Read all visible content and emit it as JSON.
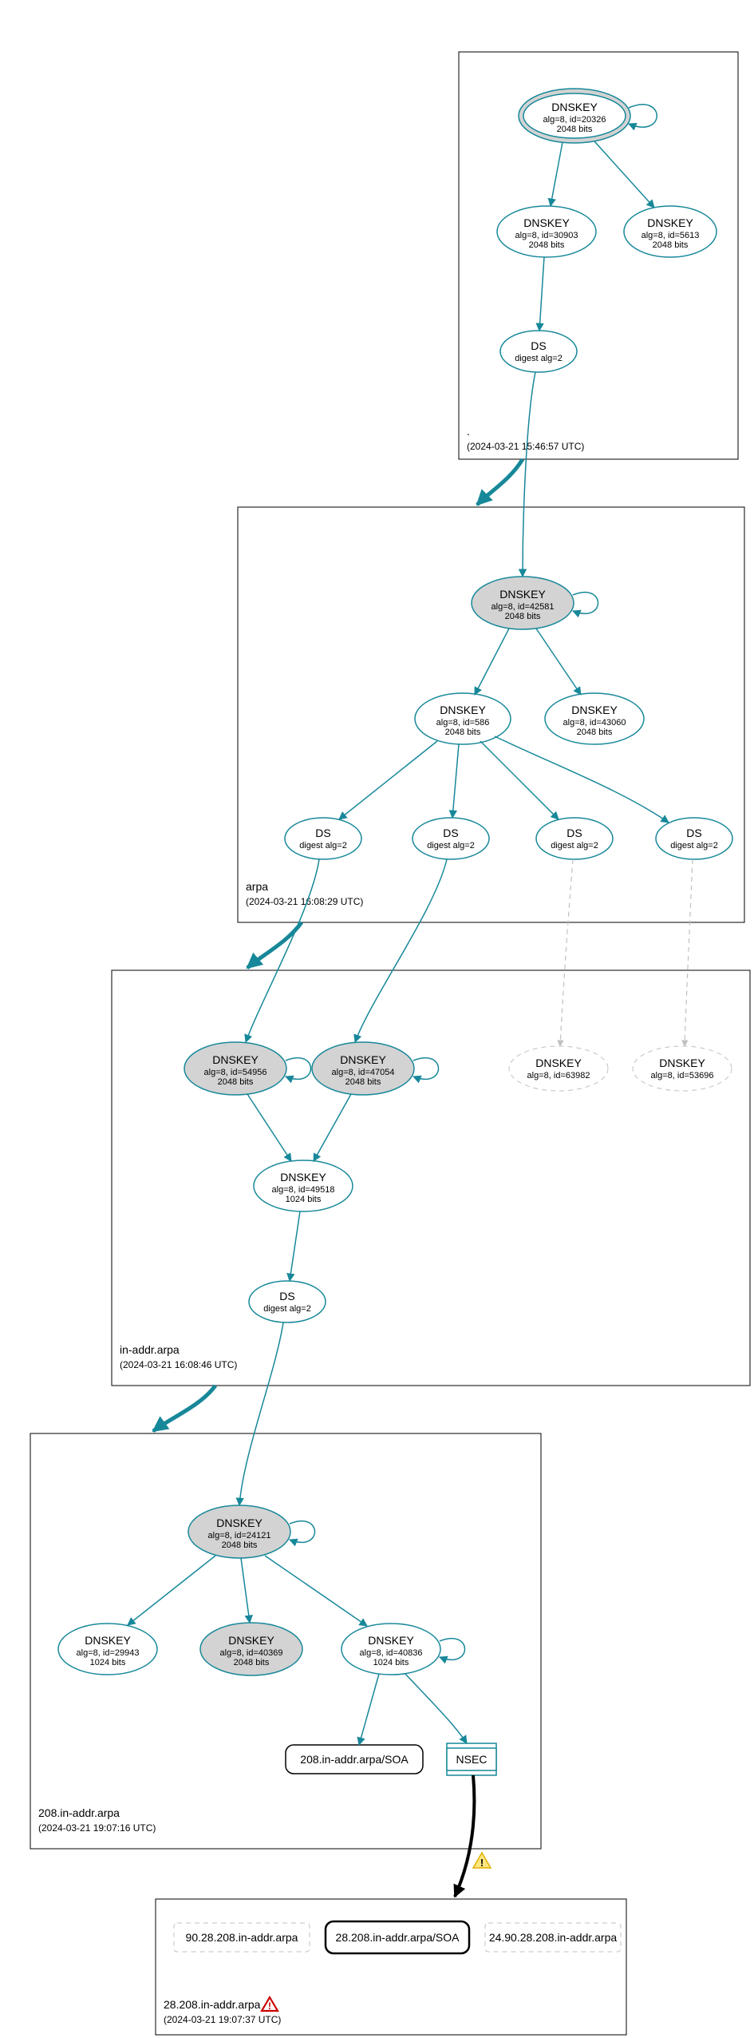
{
  "zones": {
    "root": {
      "label": ".",
      "timestamp": "(2024-03-21 15:46:57 UTC)"
    },
    "arpa": {
      "label": "arpa",
      "timestamp": "(2024-03-21 16:08:29 UTC)"
    },
    "inaddr": {
      "label": "in-addr.arpa",
      "timestamp": "(2024-03-21 16:08:46 UTC)"
    },
    "z208": {
      "label": "208.in-addr.arpa",
      "timestamp": "(2024-03-21 19:07:16 UTC)"
    },
    "z28": {
      "label": "28.208.in-addr.arpa",
      "timestamp": "(2024-03-21 19:07:37 UTC)"
    }
  },
  "nodes": {
    "root_ksk": {
      "title": "DNSKEY",
      "sub1": "alg=8, id=20326",
      "sub2": "2048 bits"
    },
    "root_zsk1": {
      "title": "DNSKEY",
      "sub1": "alg=8, id=30903",
      "sub2": "2048 bits"
    },
    "root_zsk2": {
      "title": "DNSKEY",
      "sub1": "alg=8, id=5613",
      "sub2": "2048 bits"
    },
    "root_ds": {
      "title": "DS",
      "sub1": "digest alg=2"
    },
    "arpa_ksk": {
      "title": "DNSKEY",
      "sub1": "alg=8, id=42581",
      "sub2": "2048 bits"
    },
    "arpa_zsk1": {
      "title": "DNSKEY",
      "sub1": "alg=8, id=586",
      "sub2": "2048 bits"
    },
    "arpa_zsk2": {
      "title": "DNSKEY",
      "sub1": "alg=8, id=43060",
      "sub2": "2048 bits"
    },
    "arpa_ds1": {
      "title": "DS",
      "sub1": "digest alg=2"
    },
    "arpa_ds2": {
      "title": "DS",
      "sub1": "digest alg=2"
    },
    "arpa_ds3": {
      "title": "DS",
      "sub1": "digest alg=2"
    },
    "arpa_ds4": {
      "title": "DS",
      "sub1": "digest alg=2"
    },
    "ia_ksk1": {
      "title": "DNSKEY",
      "sub1": "alg=8, id=54956",
      "sub2": "2048 bits"
    },
    "ia_ksk2": {
      "title": "DNSKEY",
      "sub1": "alg=8, id=47054",
      "sub2": "2048 bits"
    },
    "ia_missing1": {
      "title": "DNSKEY",
      "sub1": "alg=8, id=63982"
    },
    "ia_missing2": {
      "title": "DNSKEY",
      "sub1": "alg=8, id=53696"
    },
    "ia_zsk": {
      "title": "DNSKEY",
      "sub1": "alg=8, id=49518",
      "sub2": "1024 bits"
    },
    "ia_ds": {
      "title": "DS",
      "sub1": "digest alg=2"
    },
    "z208_ksk": {
      "title": "DNSKEY",
      "sub1": "alg=8, id=24121",
      "sub2": "2048 bits"
    },
    "z208_k1": {
      "title": "DNSKEY",
      "sub1": "alg=8, id=29943",
      "sub2": "1024 bits"
    },
    "z208_k2": {
      "title": "DNSKEY",
      "sub1": "alg=8, id=40369",
      "sub2": "2048 bits"
    },
    "z208_k3": {
      "title": "DNSKEY",
      "sub1": "alg=8, id=40836",
      "sub2": "1024 bits"
    },
    "z208_soa": {
      "label": "208.in-addr.arpa/SOA"
    },
    "z208_nsec": {
      "label": "NSEC"
    },
    "z28_a": {
      "label": "90.28.208.in-addr.arpa"
    },
    "z28_soa": {
      "label": "28.208.in-addr.arpa/SOA"
    },
    "z28_b": {
      "label": "24.90.28.208.in-addr.arpa"
    }
  }
}
